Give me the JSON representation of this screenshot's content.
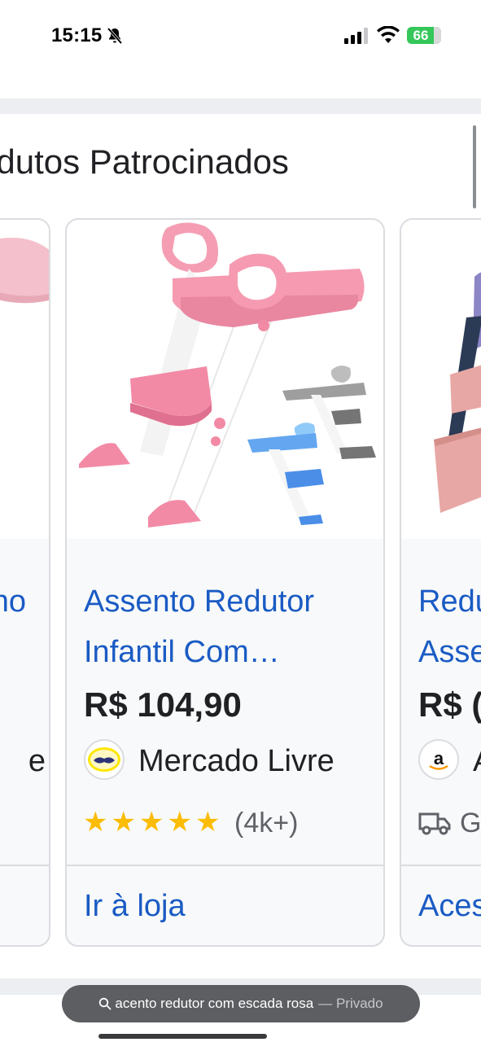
{
  "status_bar": {
    "time": "15:15",
    "battery": "66"
  },
  "section": {
    "title": "odutos Patrocinados"
  },
  "cards": [
    {
      "title_lines": [
        "",
        "no",
        ""
      ],
      "price": "",
      "seller": "e",
      "store_link": ""
    },
    {
      "title_lines": [
        "Assento Redutor",
        "Infantil Com…"
      ],
      "price": "R$ 104,90",
      "seller": "Mercado Livre",
      "rating_stars": 5,
      "reviews": "(4k+)",
      "store_link": "Ir à loja"
    },
    {
      "title_lines": [
        "Redu",
        "Asse"
      ],
      "price": "R$ (",
      "seller": "A",
      "shipping": "G",
      "store_link": "Aces"
    }
  ],
  "footer": {
    "query": "acento redutor com escada rosa",
    "private_label": "— Privado"
  },
  "colors": {
    "link": "#1a5bc4",
    "star": "#fbbc04",
    "battery": "#34c759"
  }
}
